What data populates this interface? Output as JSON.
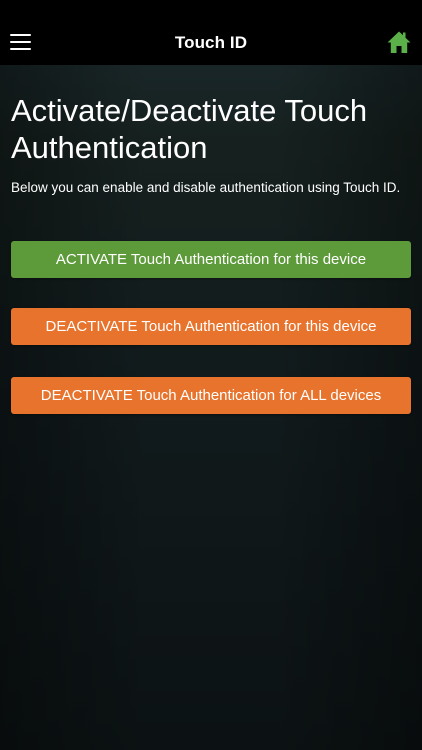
{
  "navbar": {
    "title": "Touch ID",
    "menu_icon": "hamburger-menu-icon",
    "home_icon": "home-icon",
    "home_color": "#5cb04a"
  },
  "main": {
    "title": "Activate/Deactivate Touch Authentication",
    "description": "Below you can enable and disable authentication using Touch ID.",
    "buttons": {
      "activate_device": "ACTIVATE Touch Authentication for this device",
      "deactivate_device": "DEACTIVATE Touch Authentication for this device",
      "deactivate_all": "DEACTIVATE Touch Authentication for ALL devices"
    }
  },
  "colors": {
    "activate": "#5c9a3a",
    "deactivate": "#e8732c",
    "background": "#111a1c"
  }
}
